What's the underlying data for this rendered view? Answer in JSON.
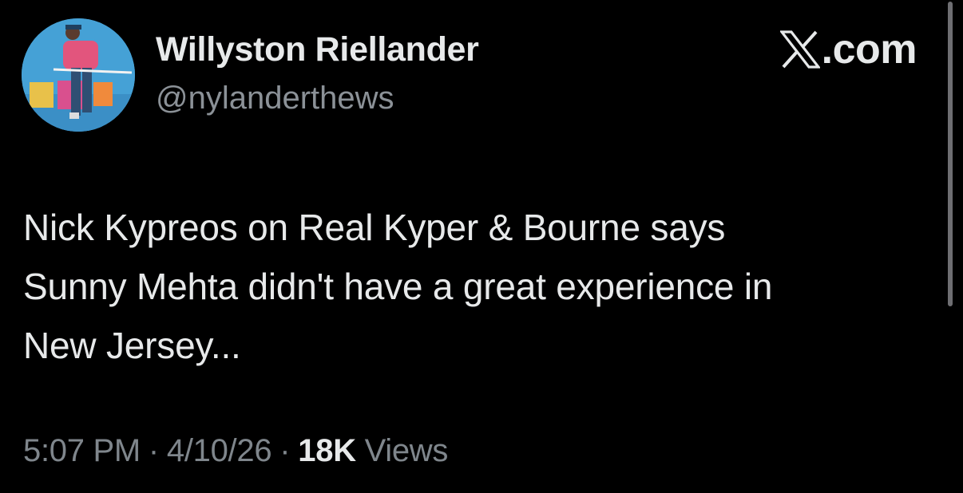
{
  "author": {
    "display_name": "Willyston Riellander",
    "handle": "@nylanderthews",
    "avatar_icon": "profile-photo-avatar"
  },
  "brand": {
    "label": ".com",
    "icon": "x-logo-icon"
  },
  "tweet": {
    "text_lines": [
      "Nick Kypreos on Real Kyper & Bourne says",
      "Sunny Mehta didn't have a great experience in",
      "New Jersey..."
    ]
  },
  "meta": {
    "time": "5:07 PM",
    "date": "4/10/26",
    "separator": "·",
    "views_count": "18K",
    "views_label": "Views"
  },
  "colors": {
    "background": "#000000",
    "primary_text": "#e7e9ea",
    "secondary_text": "#8b9197"
  }
}
